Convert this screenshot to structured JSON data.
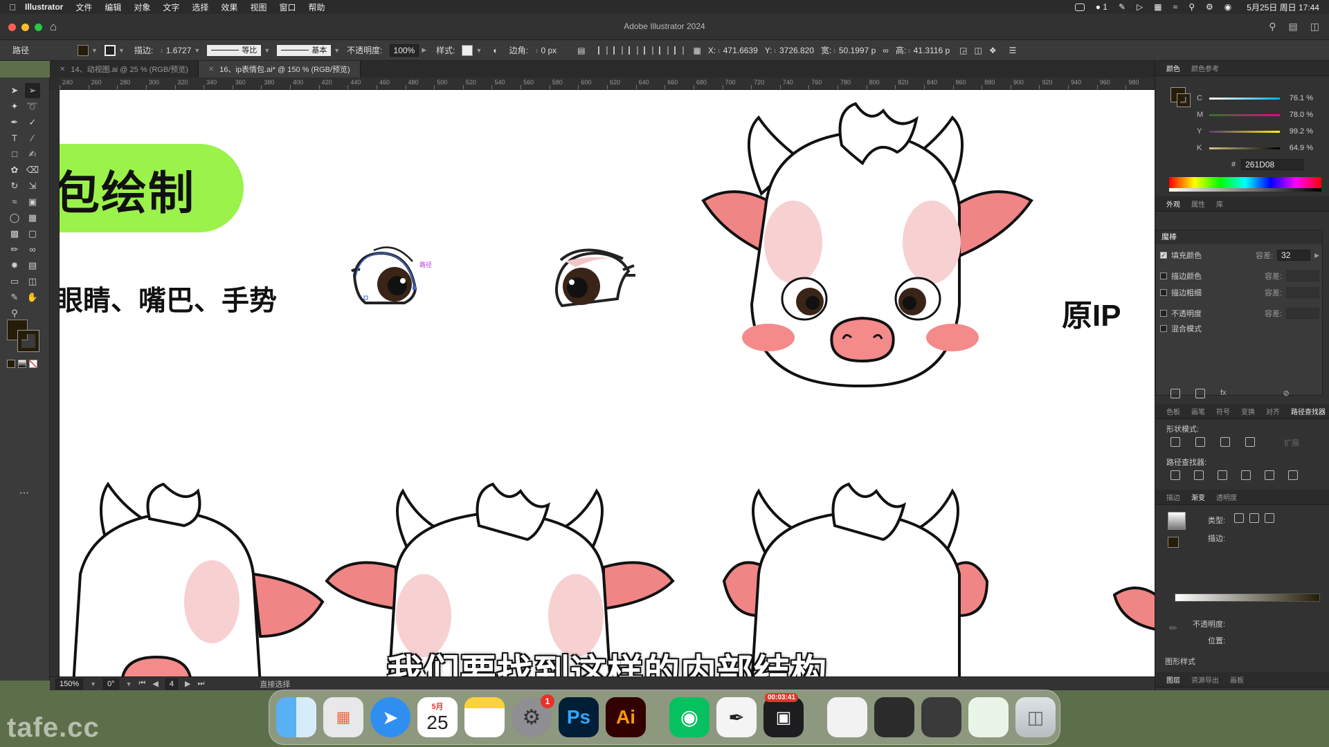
{
  "menubar": {
    "app_name": "Illustrator",
    "items": [
      "文件",
      "编辑",
      "对象",
      "文字",
      "选择",
      "效果",
      "视图",
      "窗口",
      "帮助"
    ],
    "wechat_count": "1",
    "datetime": "5月25日 周日 17:44"
  },
  "window": {
    "title": "Adobe Illustrator 2024"
  },
  "control": {
    "selection_label": "路径",
    "stroke_label": "描边:",
    "stroke_width": "1.6727",
    "profile_label": "等比",
    "brush_label": "基本",
    "opacity_label": "不透明度:",
    "opacity_value": "100%",
    "style_label": "样式:",
    "corner_label": "边角:",
    "corner_value": "0 px",
    "x_label": "X:",
    "x_value": "471.6639",
    "y_label": "Y:",
    "y_value": "3726.820",
    "w_label": "宽:",
    "w_value": "50.1997 p",
    "h_label": "高:",
    "h_value": "41.3116 p"
  },
  "tabs": [
    {
      "label": "14、动视图.ai @ 25 % (RGB/预览)",
      "active": false
    },
    {
      "label": "16、ip表情包.ai* @ 150 % (RGB/预览)",
      "active": true
    }
  ],
  "ruler_ticks": [
    "240",
    "260",
    "280",
    "300",
    "320",
    "340",
    "360",
    "380",
    "400",
    "420",
    "440",
    "460",
    "480",
    "500",
    "520",
    "540",
    "560",
    "580",
    "600",
    "620",
    "640",
    "660",
    "680",
    "700",
    "720",
    "740",
    "760",
    "780",
    "800",
    "820",
    "840",
    "860",
    "880",
    "900",
    "920",
    "940",
    "960",
    "980"
  ],
  "canvas": {
    "banner_text": "包绘制",
    "sub_text": "眼睛、嘴巴、手势",
    "origin_label": "原IP",
    "selection_hint": "路径",
    "subtitle": "我们要找到这样的内部结构"
  },
  "status": {
    "zoom": "150%",
    "angle": "0°",
    "artboard": "4",
    "tool_name": "直接选择"
  },
  "color_panel": {
    "tabs": [
      "颜色",
      "颜色参考"
    ],
    "c_label": "C",
    "c_value": "76.1",
    "m_label": "M",
    "m_value": "78.0",
    "y_label": "Y",
    "y_value": "99.2",
    "k_label": "K",
    "k_value": "64.9",
    "percent": "%",
    "hex_symbol": "#",
    "hex": "261D08",
    "fill_color": "#261d08"
  },
  "appearance_tabs": [
    "外观",
    "属性",
    "库"
  ],
  "magic_wand": {
    "title": "魔棒",
    "rows": [
      {
        "label": "填充颜色",
        "checked": true,
        "tol_label": "容差:",
        "tol_value": "32"
      },
      {
        "label": "描边颜色",
        "checked": false,
        "tol_label": "容差:",
        "tol_value": ""
      },
      {
        "label": "描边粗细",
        "checked": false,
        "tol_label": "容差:",
        "tol_value": ""
      },
      {
        "label": "不透明度",
        "checked": false,
        "tol_label": "容差:",
        "tol_value": ""
      },
      {
        "label": "混合模式",
        "checked": false,
        "tol_label": "",
        "tol_value": ""
      }
    ]
  },
  "pathfinder": {
    "tabs": [
      "色板",
      "画笔",
      "符号",
      "变换",
      "对齐",
      "路径查找器"
    ],
    "shape_modes": "形状模式:",
    "expand": "扩展",
    "pathfinders": "路径查找器:"
  },
  "gradient_panel": {
    "tabs": [
      "描边",
      "渐变",
      "透明度"
    ],
    "type_label": "类型:",
    "stroke_label": "描边:",
    "opacity_label": "不透明度:",
    "location_label": "位置:"
  },
  "graphic_styles": "图形样式",
  "bottom_tabs": [
    "图层",
    "资源导出",
    "画板"
  ],
  "dock": {
    "calendar_month": "5月",
    "calendar_day": "25",
    "settings_badge": "1",
    "recorder_time": "00:03:41",
    "ps_label": "Ps",
    "ai_label": "Ai"
  },
  "watermark": "tafe.cc"
}
